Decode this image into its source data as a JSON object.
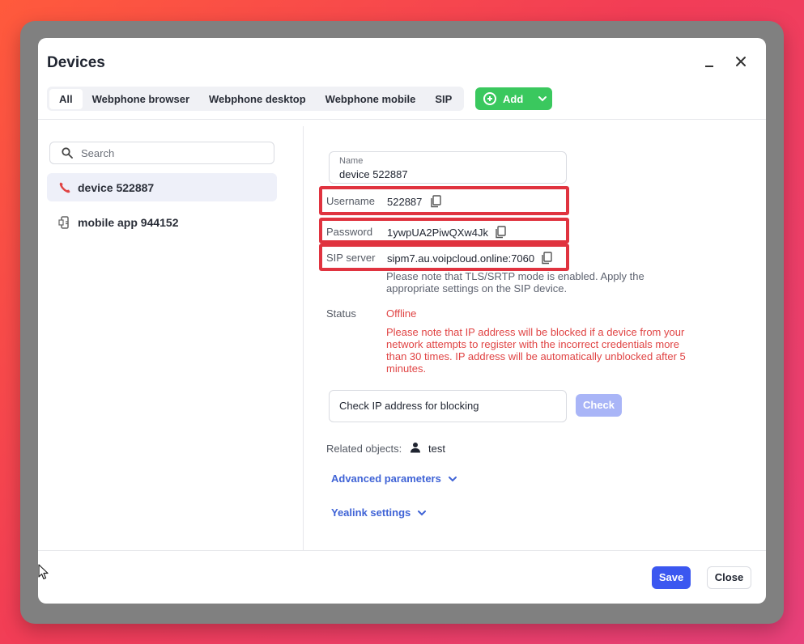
{
  "window": {
    "title": "Devices"
  },
  "tabs": [
    {
      "label": "All",
      "active": true
    },
    {
      "label": "Webphone browser"
    },
    {
      "label": "Webphone desktop"
    },
    {
      "label": "Webphone mobile"
    },
    {
      "label": "SIP"
    }
  ],
  "add_button": {
    "label": "Add"
  },
  "search": {
    "placeholder": "Search"
  },
  "devices": [
    {
      "label": "device 522887",
      "icon": "phone-icon",
      "selected": true
    },
    {
      "label": "mobile app 944152",
      "icon": "mobile-app-icon"
    }
  ],
  "details": {
    "name_label": "Name",
    "name_value": "device 522887",
    "username_label": "Username",
    "username_value": "522887",
    "password_label": "Password",
    "password_value": "1ywpUA2PiwQXw4Jk",
    "sip_label": "SIP server",
    "sip_value": "sipm7.au.voipcloud.online:7060",
    "tls_note": "Please note that TLS/SRTP mode is enabled. Apply the appropriate settings on the SIP device.",
    "status_label": "Status",
    "status_value": "Offline",
    "block_warning": "Please note that IP address will be blocked if a device from your network attempts to register with the incorrect credentials more than 30 times. IP address will be automatically unblocked after 5 minutes.",
    "ip_check_placeholder": "Check IP address for blocking",
    "check_label": "Check",
    "related_label": "Related objects:",
    "related_value": "test",
    "advanced_label": "Advanced parameters",
    "yealink_label": "Yealink settings"
  },
  "footer": {
    "save_label": "Save",
    "close_label": "Close"
  },
  "colors": {
    "accent_blue": "#3b57f0",
    "add_green": "#3ac85e",
    "error_red": "#e04444",
    "highlight_red": "#e0333f",
    "link_blue": "#3f63d6"
  }
}
